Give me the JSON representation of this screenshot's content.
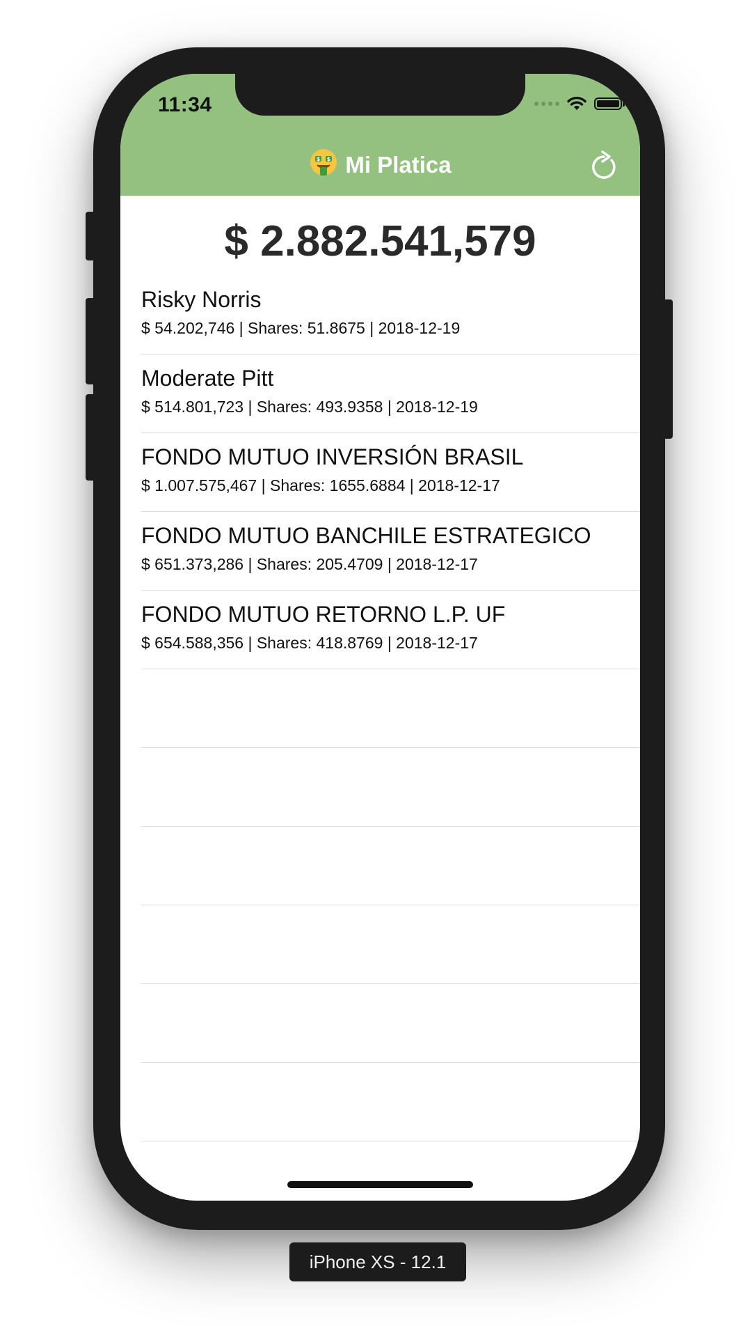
{
  "status_bar": {
    "time": "11:34"
  },
  "nav": {
    "emoji": "🤑",
    "title": "Mi Platica",
    "refresh_icon": "refresh-icon"
  },
  "colors": {
    "header": "#94c180",
    "device": "#1c1c1c"
  },
  "total": "$ 2.882.541,579",
  "funds": [
    {
      "name": "Risky Norris",
      "detail": "$ 54.202,746 | Shares: 51.8675 | 2018-12-19"
    },
    {
      "name": "Moderate Pitt",
      "detail": "$ 514.801,723 | Shares: 493.9358 | 2018-12-19"
    },
    {
      "name": "FONDO MUTUO INVERSIÓN BRASIL",
      "detail": "$ 1.007.575,467 | Shares: 1655.6884 | 2018-12-17"
    },
    {
      "name": "FONDO MUTUO BANCHILE ESTRATEGICO",
      "detail": "$ 651.373,286 | Shares: 205.4709 | 2018-12-17"
    },
    {
      "name": "FONDO MUTUO RETORNO L.P. UF",
      "detail": "$ 654.588,356 | Shares: 418.8769 | 2018-12-17"
    }
  ],
  "device_label": "iPhone XS - 12.1"
}
